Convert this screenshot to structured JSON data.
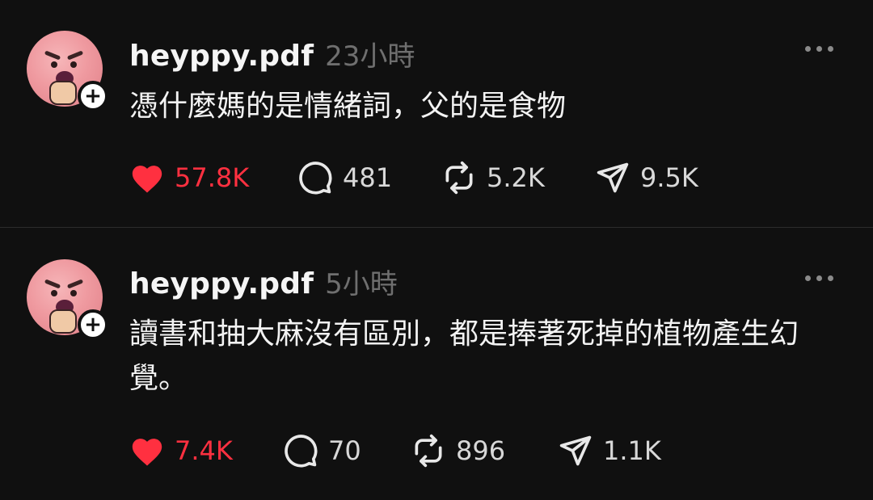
{
  "posts": [
    {
      "username": "heyppy.pdf",
      "timestamp": "23小時",
      "text": "憑什麼媽的是情緒詞，父的是食物",
      "likes": "57.8K",
      "replies": "481",
      "reposts": "5.2K",
      "shares": "9.5K",
      "liked": true
    },
    {
      "username": "heyppy.pdf",
      "timestamp": "5小時",
      "text": "讀書和抽大麻沒有區別，都是捧著死掉的植物產生幻覺。",
      "likes": "7.4K",
      "replies": "70",
      "reposts": "896",
      "shares": "1.1K",
      "liked": true
    }
  ],
  "icons": {
    "like": "heart-icon",
    "reply": "comment-bubble-icon",
    "repost": "repost-icon",
    "share": "send-icon",
    "more": "more-dots-icon",
    "follow": "plus-icon"
  },
  "colors": {
    "background": "#101010",
    "like_active": "#ff3040",
    "secondary_text": "#6f6f6f"
  }
}
